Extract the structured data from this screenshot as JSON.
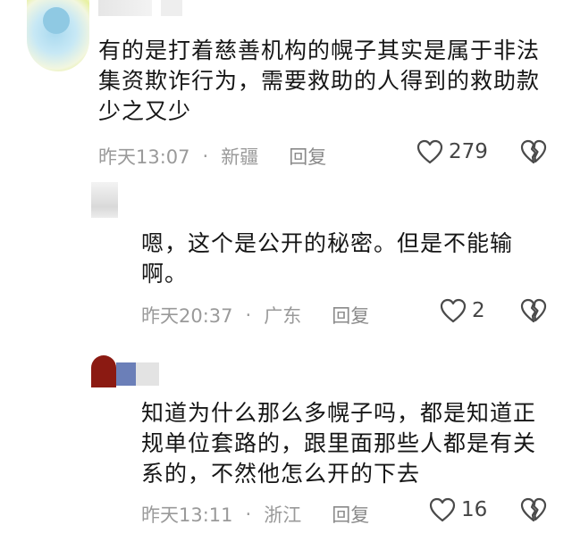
{
  "comments": [
    {
      "text": "有的是打着慈善机构的幌子其实是属于非法\n集资欺诈行为，需要救助的人得到的救助款\n少之又少",
      "time": "昨天13:07",
      "location": "新疆",
      "reply_label": "回复",
      "likes": "279"
    },
    {
      "text": "嗯，这个是公开的秘密。但是不能输\n啊。",
      "time": "昨天20:37",
      "location": "广东",
      "reply_label": "回复",
      "likes": "2"
    },
    {
      "text": "知道为什么那么多幌子吗，都是知道正\n规单位套路的，跟里面那些人都是有关\n系的，不然他怎么开的下去",
      "time": "昨天13:11",
      "location": "浙江",
      "reply_label": "回复",
      "likes": "16"
    }
  ],
  "separator": "·",
  "icons": {
    "like": "heart-outline-icon",
    "dislike": "broken-heart-icon"
  },
  "colors": {
    "text": "#161616",
    "meta": "#9a9a9a",
    "avatar_red": "#8b1a12",
    "avatar_blue": "#6b7fb8"
  }
}
